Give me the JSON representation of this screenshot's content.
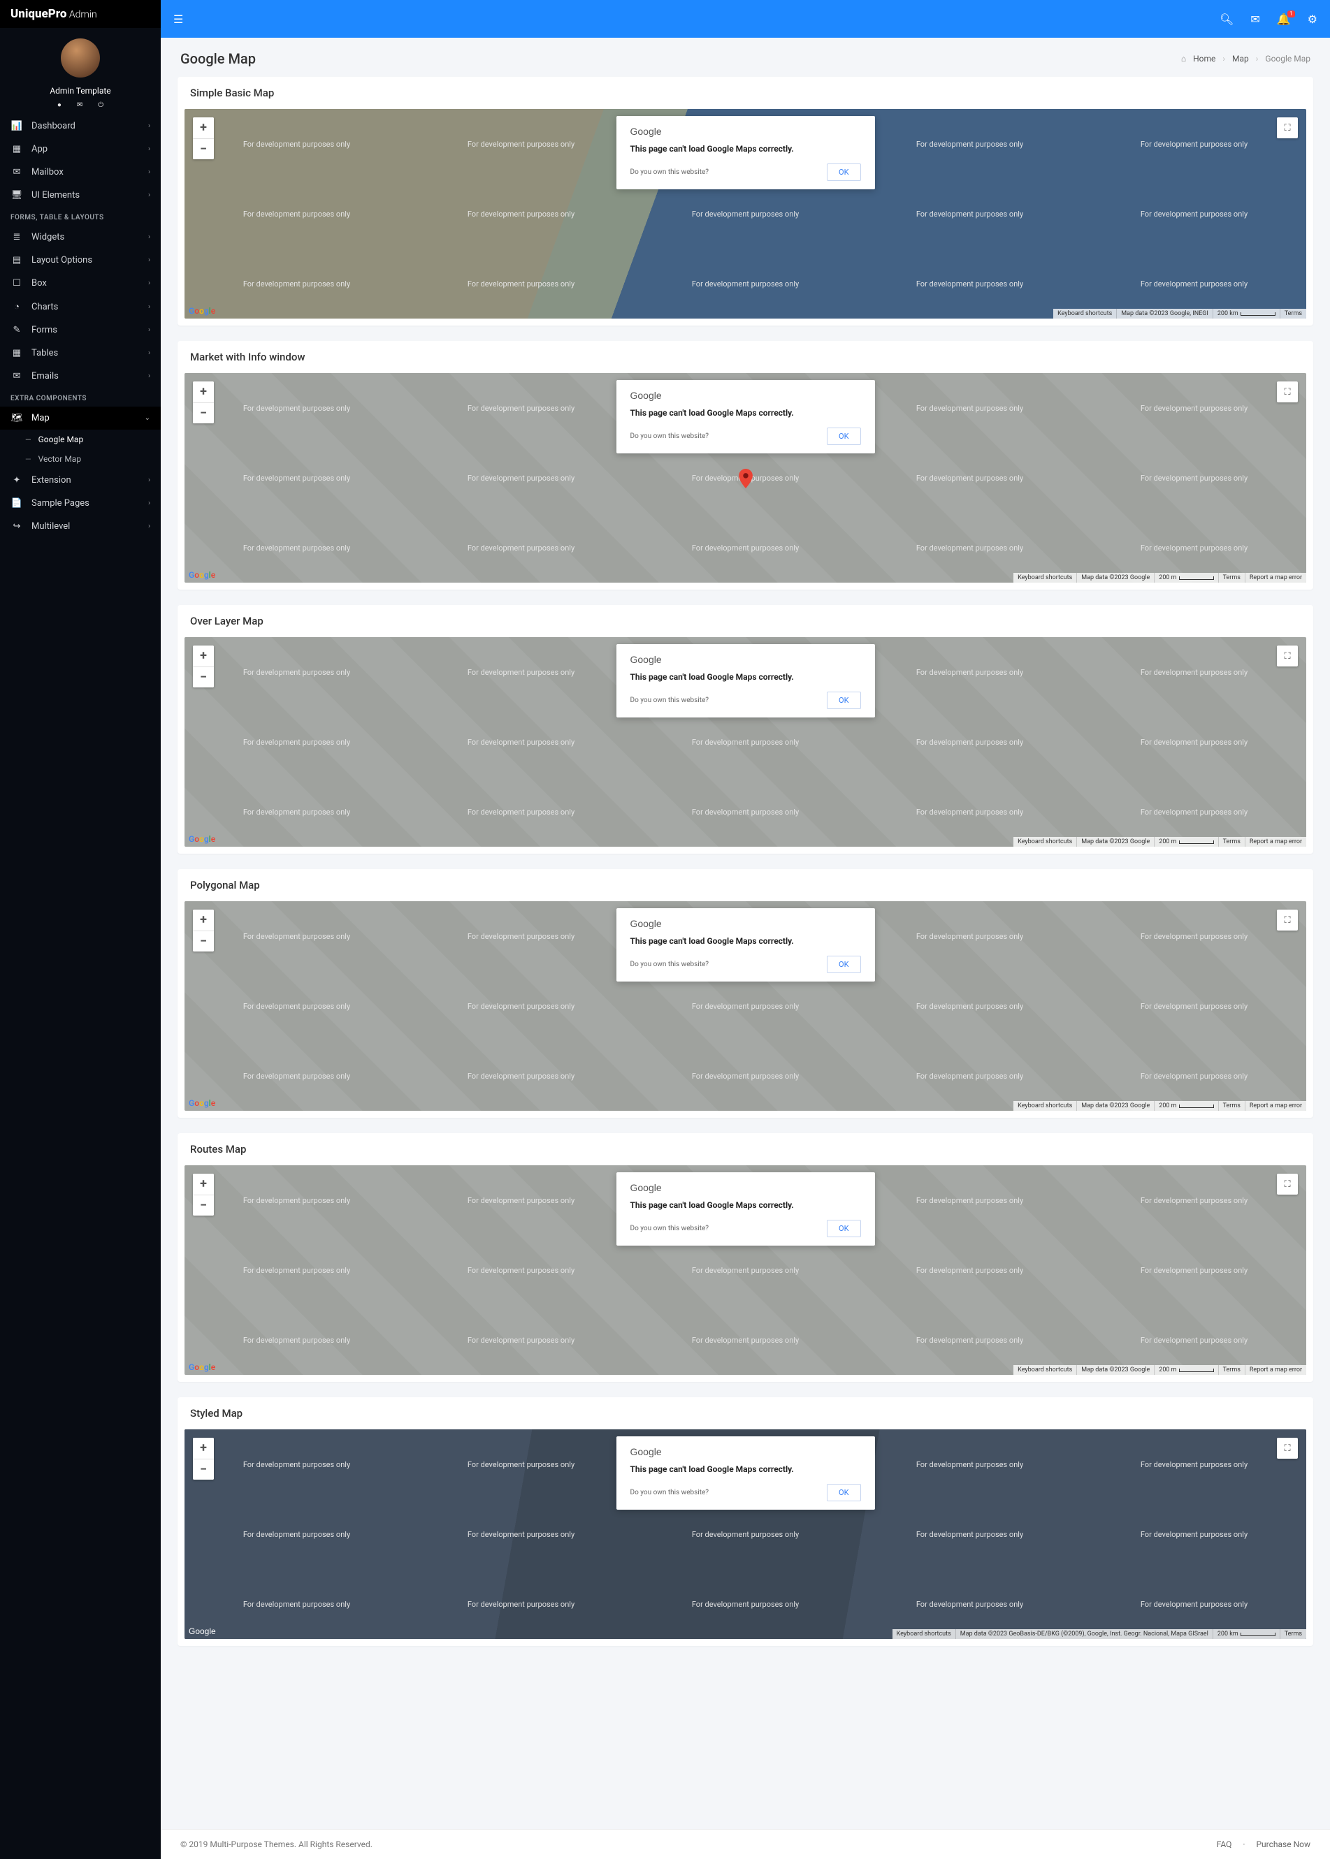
{
  "brand": {
    "name": "UniquePro",
    "suffix": "Admin"
  },
  "user": {
    "name": "Admin Template"
  },
  "topbar": {
    "notif_badge": "1"
  },
  "page": {
    "title": "Google Map"
  },
  "breadcrumb": {
    "home": "Home",
    "section": "Map",
    "current": "Google Map"
  },
  "nav": {
    "items": [
      {
        "label": "Dashboard"
      },
      {
        "label": "App"
      },
      {
        "label": "Mailbox"
      },
      {
        "label": "UI Elements"
      }
    ],
    "section1": "FORMS, TABLE & LAYOUTS",
    "items2": [
      {
        "label": "Widgets"
      },
      {
        "label": "Layout Options"
      },
      {
        "label": "Box"
      },
      {
        "label": "Charts"
      },
      {
        "label": "Forms"
      },
      {
        "label": "Tables"
      },
      {
        "label": "Emails"
      }
    ],
    "section2": "EXTRA COMPONENTS",
    "map_label": "Map",
    "sub": [
      {
        "label": "Google Map"
      },
      {
        "label": "Vector Map"
      }
    ],
    "items3": [
      {
        "label": "Extension"
      },
      {
        "label": "Sample Pages"
      },
      {
        "label": "Multilevel"
      }
    ]
  },
  "maps": [
    {
      "title": "Simple Basic Map",
      "credits": {
        "ks": "Keyboard shortcuts",
        "data": "Map data ©2023 Google, INEGI",
        "scale": "200 km",
        "terms": "Terms",
        "report": ""
      },
      "bg": "terrain",
      "logo": "color"
    },
    {
      "title": "Market with Info window",
      "credits": {
        "ks": "Keyboard shortcuts",
        "data": "Map data ©2023 Google",
        "scale": "200 m",
        "terms": "Terms",
        "report": "Report a map error"
      },
      "bg": "road",
      "logo": "color",
      "marker": true
    },
    {
      "title": "Over Layer Map",
      "credits": {
        "ks": "Keyboard shortcuts",
        "data": "Map data ©2023 Google",
        "scale": "200 m",
        "terms": "Terms",
        "report": "Report a map error"
      },
      "bg": "road",
      "logo": "color"
    },
    {
      "title": "Polygonal Map",
      "credits": {
        "ks": "Keyboard shortcuts",
        "data": "Map data ©2023 Google",
        "scale": "200 m",
        "terms": "Terms",
        "report": "Report a map error"
      },
      "bg": "road",
      "logo": "color"
    },
    {
      "title": "Routes Map",
      "credits": {
        "ks": "Keyboard shortcuts",
        "data": "Map data ©2023 Google",
        "scale": "200 m",
        "terms": "Terms",
        "report": "Report a map error"
      },
      "bg": "road",
      "logo": "color"
    },
    {
      "title": "Styled Map",
      "credits": {
        "ks": "Keyboard shortcuts",
        "data": "Map data ©2023 GeoBasis-DE/BKG (©2009), Google, Inst. Geogr. Nacional, Mapa GISrael",
        "scale": "200 km",
        "terms": "Terms",
        "report": ""
      },
      "bg": "dark",
      "logo": "white"
    }
  ],
  "dialog": {
    "brand": "Google",
    "msg": "This page can't load Google Maps correctly.",
    "own": "Do you own this website?",
    "ok": "OK"
  },
  "zoom": {
    "in": "+",
    "out": "−"
  },
  "google_letters": [
    "G",
    "o",
    "o",
    "g",
    "l",
    "e"
  ],
  "google_text": "Google",
  "dev_text": "For development purposes only",
  "footer": {
    "copyright": "© 2019 Multi-Purpose Themes. All Rights Reserved.",
    "faq": "FAQ",
    "purchase": "Purchase Now"
  }
}
